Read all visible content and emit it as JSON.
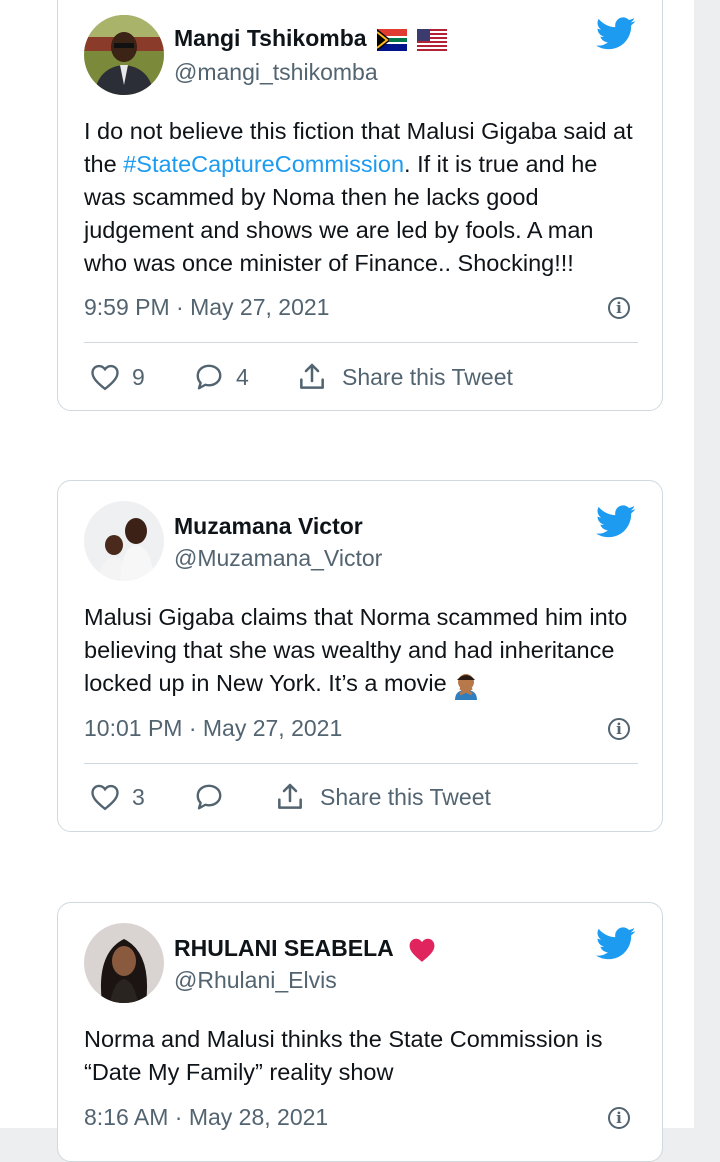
{
  "colors": {
    "accent": "#1d9bf0",
    "muted": "#536471",
    "border": "#cfd9de",
    "heart": "#e0245e"
  },
  "tweets": [
    {
      "name": "Mangi Tshikomba",
      "handle": "@mangi_tshikomba",
      "name_emoji": [
        "south-africa-flag",
        "usa-flag"
      ],
      "text_before": "I do not believe this fiction that Malusi Gigaba said at the ",
      "hashtag": "#StateCaptureCommission",
      "text_after": ". If it is true and he was scammed by Noma then he lacks good judgement and shows we are led by fools. A man who was once minister of Finance.. Shocking!!!",
      "time": "9:59 PM · May 27, 2021",
      "likes": "9",
      "replies": "4",
      "share_label": "Share this Tweet"
    },
    {
      "name": "Muzamana Victor",
      "handle": "@Muzamana_Victor",
      "text": "Malusi Gigaba claims that Norma scammed him into believing that she was wealthy and had inheritance locked up in New York. It’s a movie",
      "text_emoji": "person-gesturing-no-emoji",
      "time": "10:01 PM · May 27, 2021",
      "likes": "3",
      "share_label": "Share this Tweet"
    },
    {
      "name": "RHULANI SEABELA",
      "handle": "@Rhulani_Elvis",
      "name_emoji": [
        "red-heart"
      ],
      "text": "Norma and Malusi thinks the State Commission is “Date My Family” reality show",
      "time": "8:16 AM · May 28, 2021"
    }
  ]
}
